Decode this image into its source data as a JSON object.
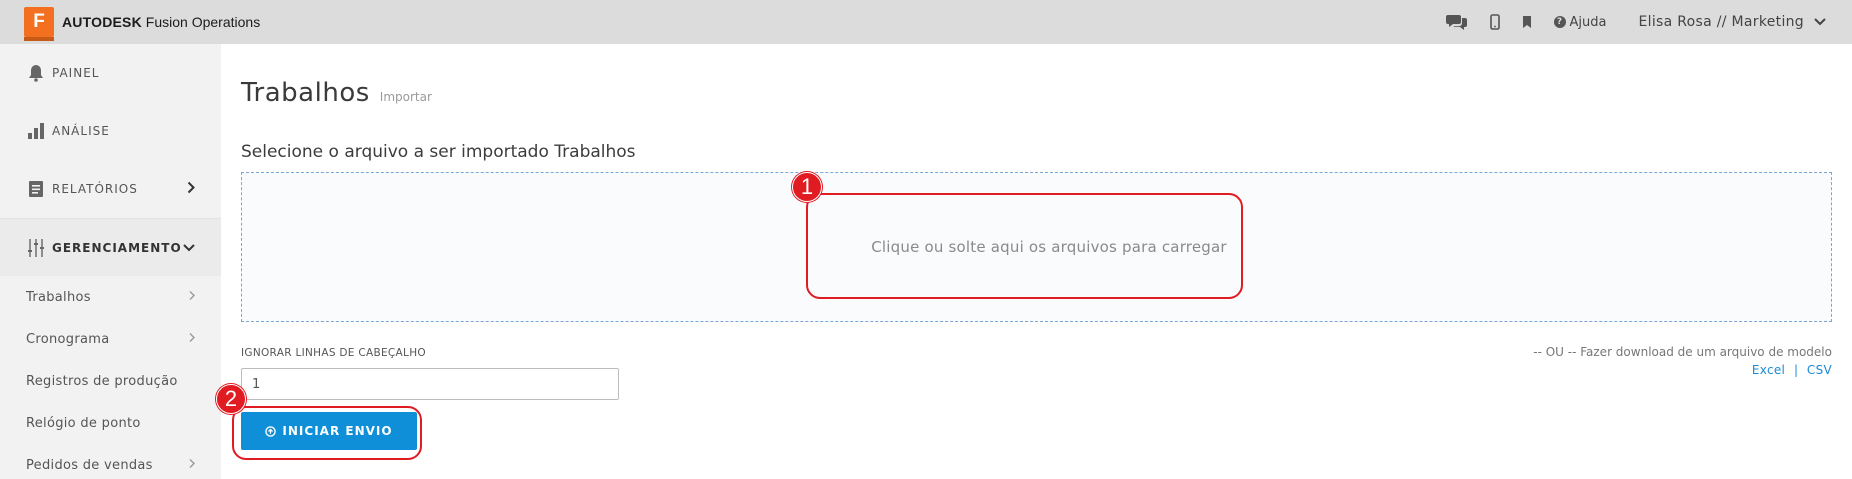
{
  "header": {
    "logo_letter": "F",
    "brand": "AUTODESK",
    "product": "Fusion Operations",
    "help_label": "Ajuda",
    "user_label": "Elisa Rosa // Marketing"
  },
  "sidebar": {
    "main_items": [
      {
        "label": "PAINEL"
      },
      {
        "label": "ANÁLISE"
      },
      {
        "label": "RELATÓRIOS"
      },
      {
        "label": "GERENCIAMENTO"
      }
    ],
    "sub_items": [
      {
        "label": "Trabalhos"
      },
      {
        "label": "Cronograma"
      },
      {
        "label": "Registros de produção"
      },
      {
        "label": "Relógio de ponto"
      },
      {
        "label": "Pedidos de vendas"
      }
    ]
  },
  "main": {
    "title": "Trabalhos",
    "subtitle": "Importar",
    "select_label": "Selecione o arquivo a ser importado Trabalhos",
    "dropzone_text": "Clique ou solte aqui os arquivos para carregar",
    "ignore_label": "IGNORAR LINHAS DE CABEÇALHO",
    "ignore_value": "1",
    "start_button": "INICIAR ENVIO",
    "download_text": "-- OU -- Fazer download de um arquivo de modelo",
    "excel_link": "Excel",
    "link_separator": "|",
    "csv_link": "CSV"
  },
  "annotations": {
    "badge_1": "1",
    "badge_2": "2",
    "color": "#e11b22"
  },
  "colors": {
    "primary_button": "#0e8fd8",
    "link": "#1a8bd4",
    "brand_orange": "#f37021"
  }
}
